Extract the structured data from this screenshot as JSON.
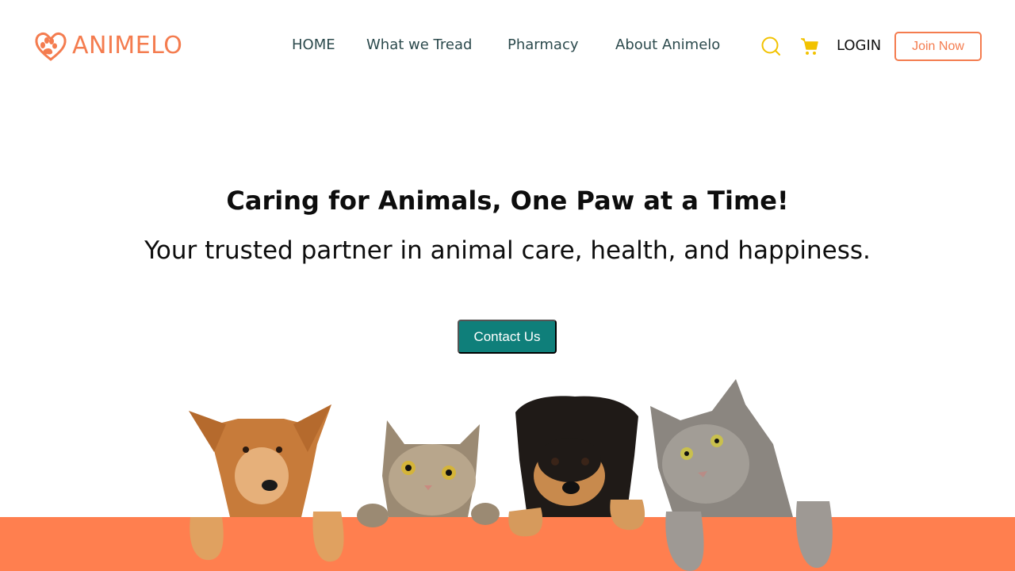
{
  "brand": {
    "name": "ANIMELO",
    "color": "#f47c4f",
    "icon": "paw-heart-icon"
  },
  "nav": {
    "items": [
      {
        "label": "HOME"
      },
      {
        "label": "What we Tread"
      },
      {
        "label": "Pharmacy"
      },
      {
        "label": "About Animelo"
      }
    ]
  },
  "actions": {
    "search_icon": "search-icon",
    "cart_icon": "cart-icon",
    "login_label": "LOGIN",
    "join_label": "Join Now"
  },
  "hero": {
    "title": "Caring for Animals, One Paw at a Time!",
    "subtitle": "Your trusted partner in animal care, health, and happiness.",
    "cta_label": "Contact Us"
  },
  "colors": {
    "accent": "#f47c4f",
    "footer_band": "#ff7f4f",
    "cta": "#0f7f7a",
    "icon_yellow": "#f2c200",
    "nav_text": "#2c4a4d"
  }
}
